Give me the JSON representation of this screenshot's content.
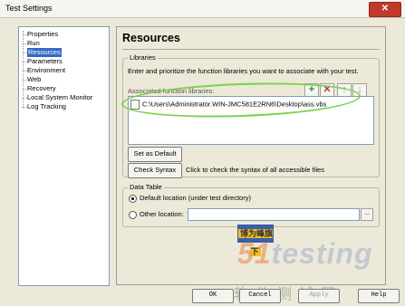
{
  "window": {
    "title": "Test Settings",
    "close_glyph": "✕"
  },
  "tree": {
    "items": [
      {
        "label": "Properties",
        "selected": false
      },
      {
        "label": "Run",
        "selected": false
      },
      {
        "label": "Resources",
        "selected": true
      },
      {
        "label": "Parameters",
        "selected": false
      },
      {
        "label": "Environment",
        "selected": false
      },
      {
        "label": "Web",
        "selected": false
      },
      {
        "label": "Recovery",
        "selected": false
      },
      {
        "label": "Local System Monitor",
        "selected": false
      },
      {
        "label": "Log Tracking",
        "selected": false
      }
    ]
  },
  "panel": {
    "title": "Resources",
    "libraries": {
      "legend": "Libraries",
      "description": "Enter and prioritize the function libraries you want to associate with your test.",
      "associated_label": "Associated function libraries:",
      "toolbar": {
        "add": "+",
        "remove": "✕",
        "up": "↑",
        "down": "↓"
      },
      "items": [
        "C:\\Users\\Administrator.WIN-JMC581E2RN6\\Desktop\\ass.vbs"
      ],
      "set_default_label": "Set as Default",
      "check_syntax_label": "Check Syntax",
      "check_syntax_note": "Click to check the syntax of all accessible files"
    },
    "data_table": {
      "legend": "Data Table",
      "default_option": "Default location (under test directory)",
      "other_option": "Other location:",
      "other_value": "",
      "browse": "..."
    }
  },
  "buttons": {
    "ok": "OK",
    "cancel": "Cancel",
    "apply": "Apply",
    "help": "Help"
  },
  "watermark": {
    "top_text": "博为峰旗下",
    "brand_num": "51",
    "brand_text": "testing",
    "bottom_text": "软件测试网"
  },
  "colors": {
    "highlight_oval": "#74d045",
    "selection": "#316ac5",
    "close": "#c0392b"
  }
}
